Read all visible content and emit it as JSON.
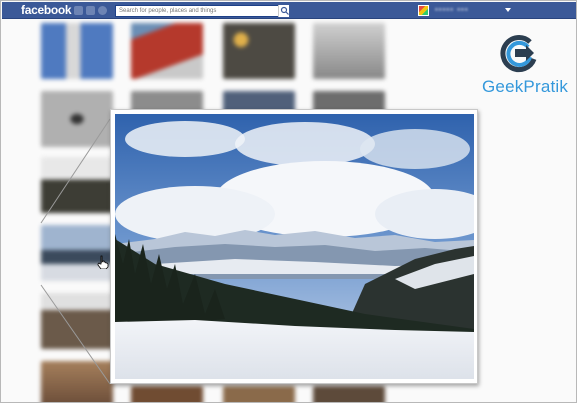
{
  "header": {
    "logo_text": "facebook",
    "search_placeholder": "Search for people, places and things",
    "profile_name_blurred": "••••• •••"
  },
  "branding": {
    "name": "GeekPratik",
    "color": "#3498db",
    "arrow_color": "#2c3e50"
  },
  "colors": {
    "fb_blue": "#3b5998",
    "sky_top": "#3d6fb8",
    "snow": "#eef0f4",
    "forest": "#1e2a1f"
  },
  "thumbnails": [
    {
      "name": "thumb-tower",
      "tone": "#6a8fc7"
    },
    {
      "name": "thumb-flag",
      "tone": "#b04a3a"
    },
    {
      "name": "thumb-star",
      "tone": "#6f5a44"
    },
    {
      "name": "thumb-gray",
      "tone": "#aaaaaa"
    },
    {
      "name": "thumb-person",
      "tone": "#8b8b8b"
    },
    {
      "name": "thumb-people",
      "tone": "#5e6b5a"
    },
    {
      "name": "thumb-mountain",
      "tone": "#8ea3bd"
    },
    {
      "name": "thumb-group",
      "tone": "#7a5a44"
    },
    {
      "name": "thumb-crowd",
      "tone": "#a17a58"
    }
  ]
}
